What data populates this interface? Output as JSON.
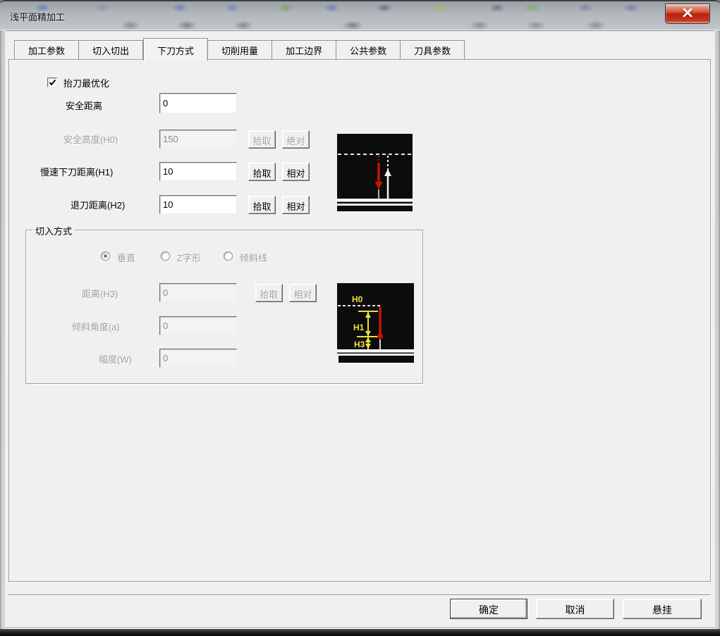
{
  "window": {
    "title": "浅平面精加工"
  },
  "tabs": {
    "active_index": 2,
    "items": [
      {
        "label": "加工参数"
      },
      {
        "label": "切入切出"
      },
      {
        "label": "下刀方式"
      },
      {
        "label": "切削用量"
      },
      {
        "label": "加工边界"
      },
      {
        "label": "公共参数"
      },
      {
        "label": "刀具参数"
      }
    ]
  },
  "form": {
    "lift_optimize": {
      "label": "抬刀最优化",
      "checked": true
    },
    "safe_distance": {
      "label": "安全距离",
      "value": "0",
      "enabled": true
    },
    "safe_height": {
      "label": "安全高度(H0)",
      "value": "150",
      "pick": "拾取",
      "mode": "绝对",
      "enabled": false
    },
    "slow_plunge": {
      "label": "慢速下刀距离(H1)",
      "value": "10",
      "pick": "拾取",
      "mode": "相对",
      "enabled": true
    },
    "retract": {
      "label": "退刀距离(H2)",
      "value": "10",
      "pick": "拾取",
      "mode": "相对",
      "enabled": true
    }
  },
  "cut_in_group": {
    "title": "切入方式",
    "radios": [
      {
        "label": "垂直",
        "selected": true
      },
      {
        "label": "Z字形",
        "selected": false
      },
      {
        "label": "倾斜线",
        "selected": false
      }
    ],
    "distance": {
      "label": "距离(H3)",
      "value": "0",
      "pick": "拾取",
      "mode": "相对",
      "enabled": false
    },
    "angle": {
      "label": "倾斜角度(a)",
      "value": "0",
      "enabled": false
    },
    "width": {
      "label": "幅度(W)",
      "value": "0",
      "enabled": false
    }
  },
  "diagram_labels": {
    "h0": "H0",
    "h1": "H1",
    "h3": "H3"
  },
  "footer": {
    "ok": "确定",
    "cancel": "取消",
    "suspend": "悬挂"
  },
  "colors": {
    "dialog_bg": "#f0f0f0",
    "diagram_red": "#cc1505",
    "diagram_yellow": "#f0e23c",
    "close_red": "#c23a22"
  }
}
